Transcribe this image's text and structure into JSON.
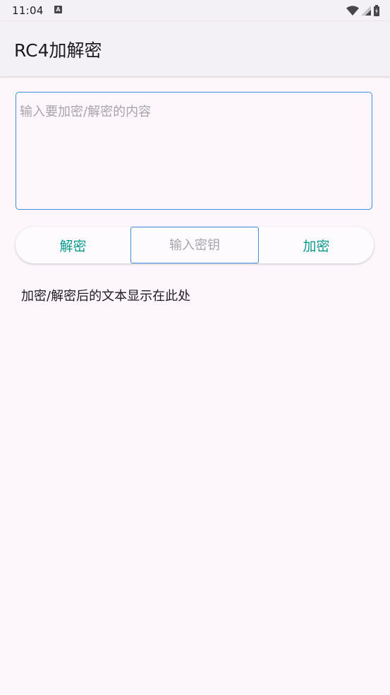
{
  "status_bar": {
    "time": "11:04",
    "notification_icon": "a-icon"
  },
  "app_bar": {
    "title": "RC4加解密"
  },
  "input": {
    "value": "",
    "placeholder": "输入要加密/解密的内容"
  },
  "actions": {
    "decrypt_label": "解密",
    "key_placeholder": "输入密钥",
    "key_value": "",
    "encrypt_label": "加密"
  },
  "result": {
    "text": "加密/解密后的文本显示在此处"
  },
  "colors": {
    "accent": "#0d9a8e",
    "focus_border": "#3d8fe0",
    "background": "#fdf7fc",
    "app_bar_background": "#f3f0f6"
  }
}
